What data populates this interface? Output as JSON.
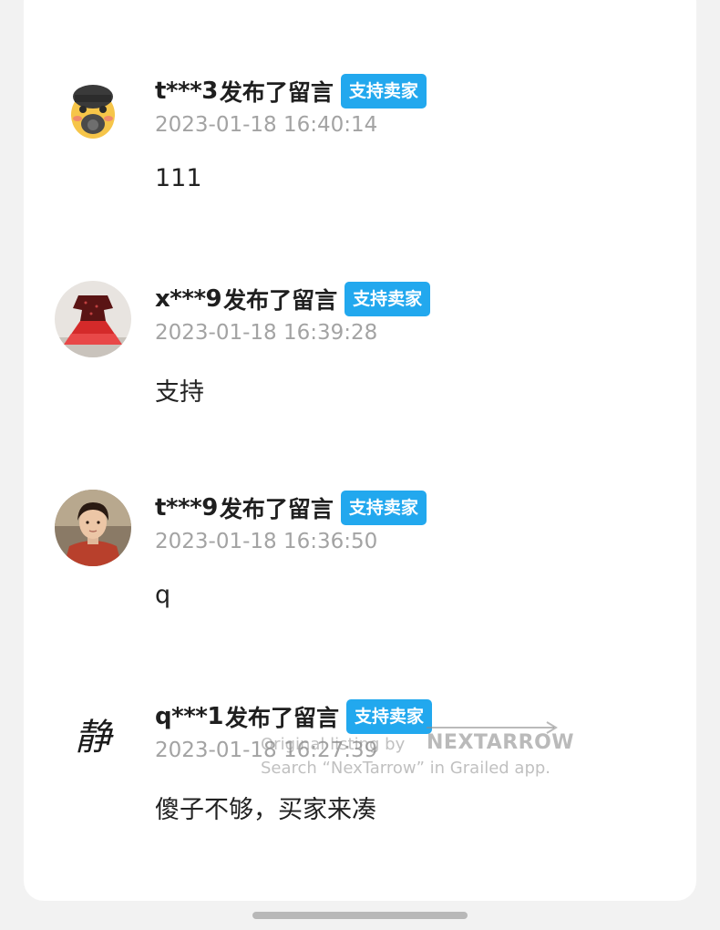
{
  "comments": [
    {
      "user": "t***3",
      "action": "发布了留言",
      "badge": "支持卖家",
      "time": "2023-01-18 16:40:14",
      "content": "111",
      "avatar_icon": "gas-mask-cartoon-avatar"
    },
    {
      "user": "x***9",
      "action": "发布了留言",
      "badge": "支持卖家",
      "time": "2023-01-18 16:39:28",
      "content": "支持",
      "avatar_icon": "red-dress-avatar"
    },
    {
      "user": "t***9",
      "action": "发布了留言",
      "badge": "支持卖家",
      "time": "2023-01-18 16:36:50",
      "content": "q",
      "avatar_icon": "portrait-photo-avatar"
    },
    {
      "user": "q***1",
      "action": "发布了留言",
      "badge": "支持卖家",
      "time": "2023-01-18 16:27:39",
      "content": "傻子不够，买家来凑",
      "avatar_icon": "calligraphy-jing-avatar",
      "avatar_text": "静"
    }
  ],
  "watermark": {
    "line1": "Original listing by",
    "brand": "NEXTARROW",
    "line2": "Search “NexTarrow” in Grailed app."
  },
  "colors": {
    "badge": "#22a8ee",
    "timestamp": "#a3a3a3"
  }
}
